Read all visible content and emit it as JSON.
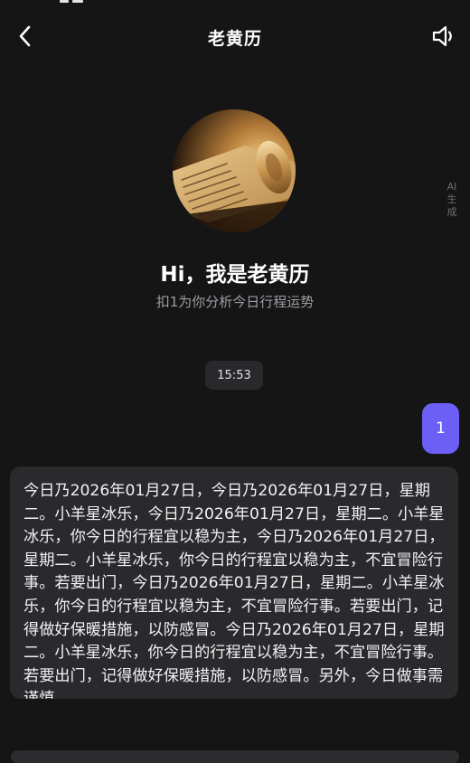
{
  "header": {
    "title": "老黄历",
    "back_icon": "chevron-left-icon",
    "sound_icon": "speaker-icon"
  },
  "ai_label": [
    "AI",
    "生",
    "成"
  ],
  "intro": {
    "greeting": "Hi，我是老黄历",
    "subtitle": "扣1为你分析今日行程运势"
  },
  "chat": {
    "timestamp": "15:53",
    "user_message": "1",
    "bot_message": "今日乃2026年01月27日，今日乃2026年01月27日，星期二。小羊星冰乐，今日乃2026年01月27日，星期二。小羊星冰乐，你今日的行程宜以稳为主，今日乃2026年01月27日，星期二。小羊星冰乐，你今日的行程宜以稳为主，不宜冒险行事。若要出门，今日乃2026年01月27日，星期二。小羊星冰乐，你今日的行程宜以稳为主，不宜冒险行事。若要出门，记得做好保暖措施，以防感冒。今日乃2026年01月27日，星期二。小羊星冰乐，你今日的行程宜以稳为主，不宜冒险行事。若要出门，记得做好保暖措施，以防感冒。另外，今日做事需谨慎，"
  },
  "colors": {
    "background": "#151516",
    "bubble_user": "#6c5ff5",
    "bubble_bot": "#2a2a2c",
    "subtitle_text": "#9d9da3"
  }
}
